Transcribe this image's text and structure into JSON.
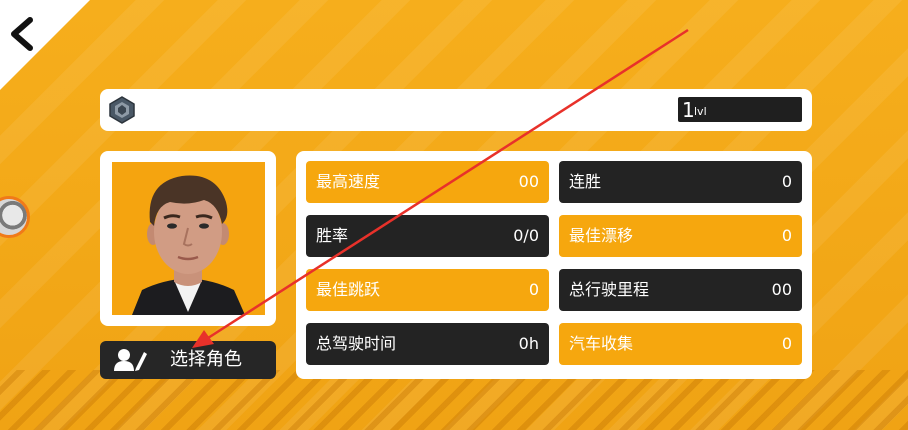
{
  "level": {
    "number": "1",
    "unit": "lvl"
  },
  "select_character": {
    "label": "选择角色"
  },
  "stats": [
    {
      "label": "最高速度",
      "value": "00",
      "style": "orange"
    },
    {
      "label": "连胜",
      "value": "0",
      "style": "dark"
    },
    {
      "label": "胜率",
      "value": "0/0",
      "style": "dark"
    },
    {
      "label": "最佳漂移",
      "value": "0",
      "style": "orange"
    },
    {
      "label": "最佳跳跃",
      "value": "0",
      "style": "orange"
    },
    {
      "label": "总行驶里程",
      "value": "00",
      "style": "dark"
    },
    {
      "label": "总驾驶时间",
      "value": "0h",
      "style": "dark"
    },
    {
      "label": "汽车收集",
      "value": "0",
      "style": "orange"
    }
  ],
  "colors": {
    "background": "#f2a516",
    "accent_orange": "#f6a70e",
    "dark_tile": "#232323",
    "annotation_arrow": "#e8312a"
  },
  "icons": {
    "back": "chevron-left-icon",
    "rank": "rank-badge-icon",
    "select": "user-edit-icon",
    "side": "wheel-knob-icon"
  }
}
